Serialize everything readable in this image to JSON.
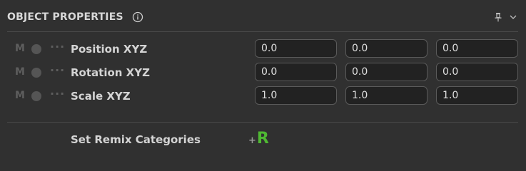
{
  "panel": {
    "title": "OBJECT PROPERTIES"
  },
  "properties": [
    {
      "modifier": "M",
      "menu": "···",
      "label": "Position  XYZ",
      "values": [
        "0.0",
        "0.0",
        "0.0"
      ]
    },
    {
      "modifier": "M",
      "menu": "···",
      "label": "Rotation  XYZ",
      "values": [
        "0.0",
        "0.0",
        "0.0"
      ]
    },
    {
      "modifier": "M",
      "menu": "···",
      "label": "Scale  XYZ",
      "values": [
        "1.0",
        "1.0",
        "1.0"
      ]
    }
  ],
  "remix": {
    "label": "Set Remix Categories",
    "button_plus": "+",
    "button_letter": "R"
  },
  "colors": {
    "background": "#303030",
    "accent_green": "#4fb833",
    "field_bg": "#222222"
  },
  "icons": {
    "info": "info-icon",
    "pin": "pin-icon",
    "collapse": "chevron-down-icon"
  }
}
